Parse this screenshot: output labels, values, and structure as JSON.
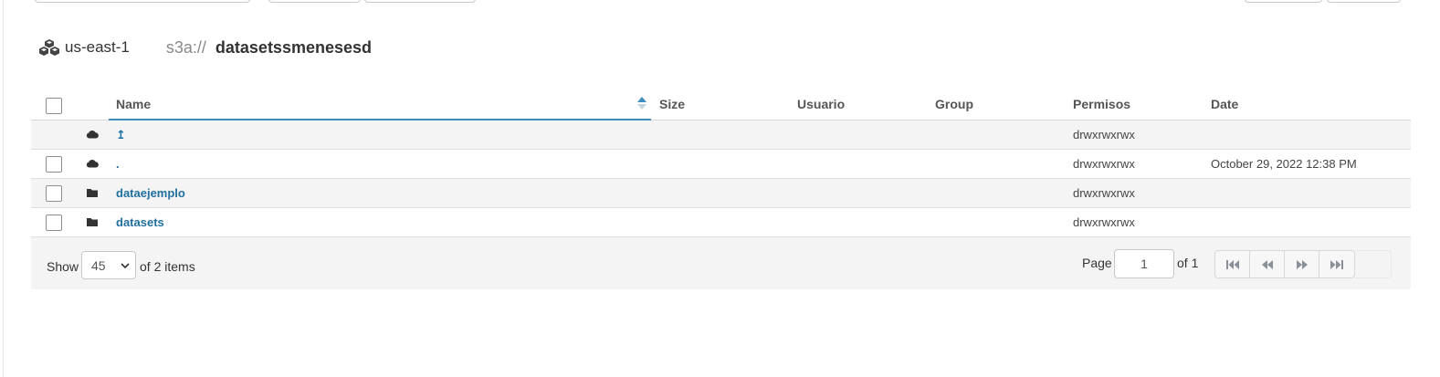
{
  "breadcrumb": {
    "icon": "cubes-icon",
    "region": "us-east-1",
    "scheme": "s3a://",
    "bucket": "datasetssmenesesd"
  },
  "table": {
    "columns": {
      "name": "Name",
      "size": "Size",
      "user": "Usuario",
      "group": "Group",
      "permissions": "Permisos",
      "date": "Date"
    },
    "sort": {
      "column": "Name",
      "direction": "ascending"
    },
    "rows": [
      {
        "icon": "cloud-icon",
        "name": "↥",
        "size": "",
        "user": "",
        "group": "",
        "permissions": "drwxrwxrwx",
        "date": "",
        "has_checkbox": false
      },
      {
        "icon": "cloud-icon",
        "name": ".",
        "size": "",
        "user": "",
        "group": "",
        "permissions": "drwxrwxrwx",
        "date": "October 29, 2022 12:38 PM",
        "has_checkbox": true
      },
      {
        "icon": "folder-icon",
        "name": "dataejemplo",
        "size": "",
        "user": "",
        "group": "",
        "permissions": "drwxrwxrwx",
        "date": "",
        "has_checkbox": true
      },
      {
        "icon": "folder-icon",
        "name": "datasets",
        "size": "",
        "user": "",
        "group": "",
        "permissions": "drwxrwxrwx",
        "date": "",
        "has_checkbox": true
      }
    ]
  },
  "footer": {
    "show_label": "Show",
    "page_size": "45",
    "items_suffix": "of 2 items",
    "page_label": "Page",
    "current_page": "1",
    "total_pages_label": "of 1",
    "pager_icons": [
      "first-page-icon",
      "previous-page-icon",
      "next-page-icon",
      "last-page-icon"
    ]
  },
  "colors": {
    "link": "#1f6f9f",
    "sort_accent": "#3c8dbc",
    "row_alt": "#f4f4f5"
  }
}
